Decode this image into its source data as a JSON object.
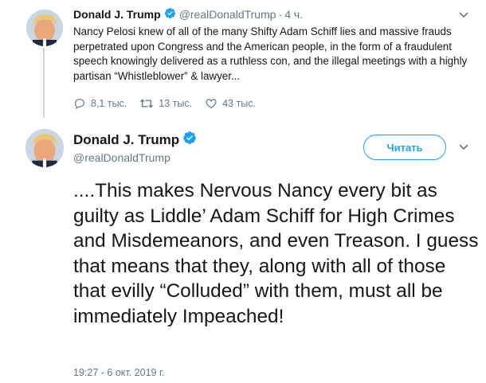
{
  "reply_tweet": {
    "author_name": "Donald J. Trump",
    "author_handle": "@realDonaldTrump",
    "separator": "·",
    "time_ago": "4 ч.",
    "text": "Nancy Pelosi knew of all of the many Shifty Adam Schiff lies and massive frauds perpetrated upon Congress and the American people, in the form of a fraudulent speech knowingly delivered as a ruthless con, and the illegal meetings with a highly partisan “Whistleblower” & lawyer...",
    "replies_count": "8,1 тыс.",
    "retweets_count": "13 тыс.",
    "likes_count": "43 тыс.",
    "reply_icon": "reply-icon",
    "retweet_icon": "retweet-icon",
    "like_icon": "heart-icon"
  },
  "main_tweet": {
    "author_name": "Donald J. Trump",
    "author_handle": "@realDonaldTrump",
    "follow_label": "Читать",
    "text": "....This makes Nervous Nancy every bit as guilty as Liddle’ Adam Schiff for High Crimes and Misdemeanors, and even Treason. I guess that means that they, along with all of those that evilly “Colluded” with them, must all be immediately Impeached!",
    "timestamp": "19:27 - 6 окт. 2019 г."
  },
  "colors": {
    "accent": "#1da1f2",
    "secondary_text": "#657786",
    "primary_text": "#14171a",
    "thread_line": "#ccd6dd"
  }
}
